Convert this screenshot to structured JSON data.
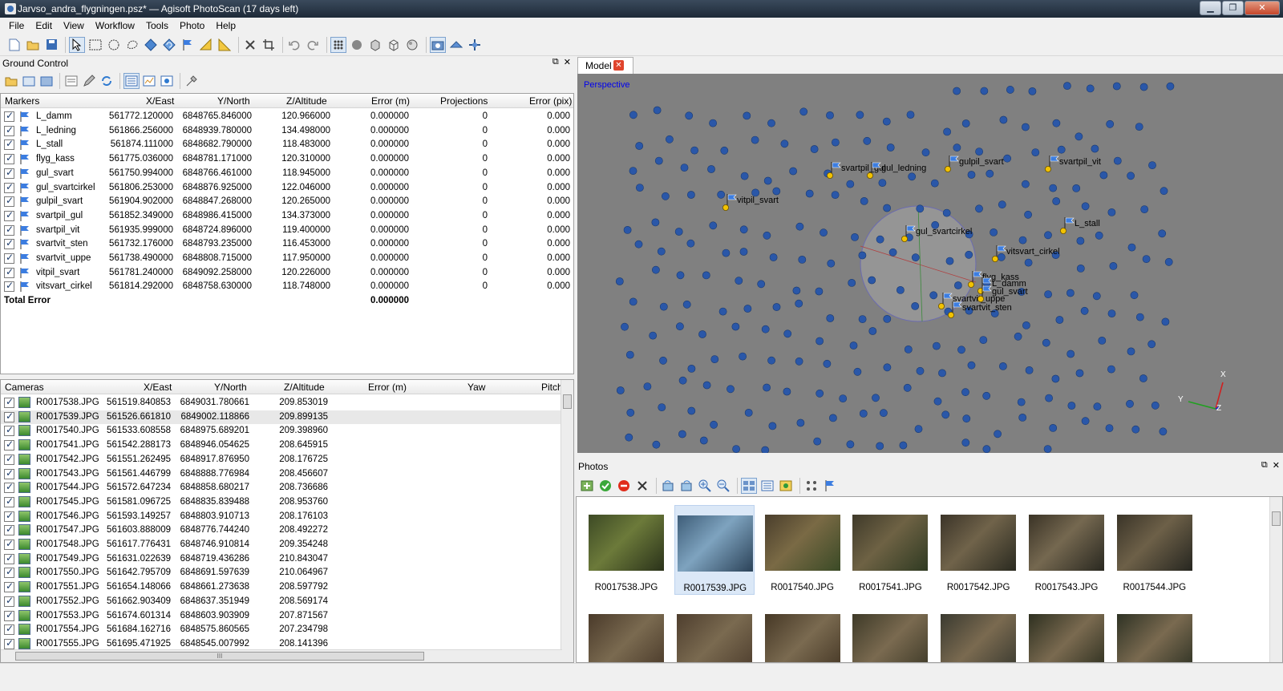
{
  "window": {
    "title": "Jarvso_andra_flygningen.psz* — Agisoft PhotoScan (17 days left)",
    "minimize": "▁",
    "maximize": "❐",
    "close": "✕"
  },
  "menu": [
    "File",
    "Edit",
    "View",
    "Workflow",
    "Tools",
    "Photo",
    "Help"
  ],
  "ground_control": {
    "title": "Ground Control",
    "float_label": "⧉",
    "close_label": "✕",
    "markers_headers": [
      "Markers",
      "X/East",
      "Y/North",
      "Z/Altitude",
      "Error (m)",
      "Projections",
      "Error (pix)"
    ],
    "markers": [
      {
        "name": "L_damm",
        "x": "561772.120000",
        "y": "6848765.846000",
        "z": "120.966000",
        "err": "0.000000",
        "proj": "0",
        "errpix": "0.000"
      },
      {
        "name": "L_ledning",
        "x": "561866.256000",
        "y": "6848939.780000",
        "z": "134.498000",
        "err": "0.000000",
        "proj": "0",
        "errpix": "0.000"
      },
      {
        "name": "L_stall",
        "x": "561874.111000",
        "y": "6848682.790000",
        "z": "118.483000",
        "err": "0.000000",
        "proj": "0",
        "errpix": "0.000"
      },
      {
        "name": "flyg_kass",
        "x": "561775.036000",
        "y": "6848781.171000",
        "z": "120.310000",
        "err": "0.000000",
        "proj": "0",
        "errpix": "0.000"
      },
      {
        "name": "gul_svart",
        "x": "561750.994000",
        "y": "6848766.461000",
        "z": "118.945000",
        "err": "0.000000",
        "proj": "0",
        "errpix": "0.000"
      },
      {
        "name": "gul_svartcirkel",
        "x": "561806.253000",
        "y": "6848876.925000",
        "z": "122.046000",
        "err": "0.000000",
        "proj": "0",
        "errpix": "0.000"
      },
      {
        "name": "gulpil_svart",
        "x": "561904.902000",
        "y": "6848847.268000",
        "z": "120.265000",
        "err": "0.000000",
        "proj": "0",
        "errpix": "0.000"
      },
      {
        "name": "svartpil_gul",
        "x": "561852.349000",
        "y": "6848986.415000",
        "z": "134.373000",
        "err": "0.000000",
        "proj": "0",
        "errpix": "0.000"
      },
      {
        "name": "svartpil_vit",
        "x": "561935.999000",
        "y": "6848724.896000",
        "z": "119.400000",
        "err": "0.000000",
        "proj": "0",
        "errpix": "0.000"
      },
      {
        "name": "svartvit_sten",
        "x": "561732.176000",
        "y": "6848793.235000",
        "z": "116.453000",
        "err": "0.000000",
        "proj": "0",
        "errpix": "0.000"
      },
      {
        "name": "svartvit_uppe",
        "x": "561738.490000",
        "y": "6848808.715000",
        "z": "117.950000",
        "err": "0.000000",
        "proj": "0",
        "errpix": "0.000"
      },
      {
        "name": "vitpil_svart",
        "x": "561781.240000",
        "y": "6849092.258000",
        "z": "120.226000",
        "err": "0.000000",
        "proj": "0",
        "errpix": "0.000"
      },
      {
        "name": "vitsvart_cirkel",
        "x": "561814.292000",
        "y": "6848758.630000",
        "z": "118.748000",
        "err": "0.000000",
        "proj": "0",
        "errpix": "0.000"
      }
    ],
    "total_error_label": "Total Error",
    "total_error_value": "0.000000",
    "cameras_headers": [
      "Cameras",
      "X/East",
      "Y/North",
      "Z/Altitude",
      "Error (m)",
      "Yaw",
      "Pitch"
    ],
    "cameras": [
      {
        "name": "R0017538.JPG",
        "x": "561519.840853",
        "y": "6849031.780661",
        "z": "209.853019"
      },
      {
        "name": "R0017539.JPG",
        "x": "561526.661810",
        "y": "6849002.118866",
        "z": "209.899135"
      },
      {
        "name": "R0017540.JPG",
        "x": "561533.608558",
        "y": "6848975.689201",
        "z": "209.398960"
      },
      {
        "name": "R0017541.JPG",
        "x": "561542.288173",
        "y": "6848946.054625",
        "z": "208.645915"
      },
      {
        "name": "R0017542.JPG",
        "x": "561551.262495",
        "y": "6848917.876950",
        "z": "208.176725"
      },
      {
        "name": "R0017543.JPG",
        "x": "561561.446799",
        "y": "6848888.776984",
        "z": "208.456607"
      },
      {
        "name": "R0017544.JPG",
        "x": "561572.647234",
        "y": "6848858.680217",
        "z": "208.736686"
      },
      {
        "name": "R0017545.JPG",
        "x": "561581.096725",
        "y": "6848835.839488",
        "z": "208.953760"
      },
      {
        "name": "R0017546.JPG",
        "x": "561593.149257",
        "y": "6848803.910713",
        "z": "208.176103"
      },
      {
        "name": "R0017547.JPG",
        "x": "561603.888009",
        "y": "6848776.744240",
        "z": "208.492272"
      },
      {
        "name": "R0017548.JPG",
        "x": "561617.776431",
        "y": "6848746.910814",
        "z": "209.354248"
      },
      {
        "name": "R0017549.JPG",
        "x": "561631.022639",
        "y": "6848719.436286",
        "z": "210.843047"
      },
      {
        "name": "R0017550.JPG",
        "x": "561642.795709",
        "y": "6848691.597639",
        "z": "210.064967"
      },
      {
        "name": "R0017551.JPG",
        "x": "561654.148066",
        "y": "6848661.273638",
        "z": "208.597792"
      },
      {
        "name": "R0017552.JPG",
        "x": "561662.903409",
        "y": "6848637.351949",
        "z": "208.569174"
      },
      {
        "name": "R0017553.JPG",
        "x": "561674.601314",
        "y": "6848603.903909",
        "z": "207.871567"
      },
      {
        "name": "R0017554.JPG",
        "x": "561684.162716",
        "y": "6848575.860565",
        "z": "207.234798"
      },
      {
        "name": "R0017555.JPG",
        "x": "561695.471925",
        "y": "6848545.007992",
        "z": "208.141396"
      }
    ],
    "hscroll_grip": "III"
  },
  "model": {
    "tab_label": "Model",
    "tab_close": "✕",
    "view_mode": "Perspective",
    "axis_labels": {
      "x": "X",
      "y": "Y",
      "z": "Z"
    },
    "marker_labels": [
      "svartpil_gul",
      "gul_ledning",
      "gulpil_svart",
      "svartpil_vit",
      "vitpil_svart",
      "gul_svartcirkel",
      "L_stall",
      "vitsvart_cirkel",
      "flyg_kass",
      "L_damm",
      "svartvit_uppe",
      "gul_svart",
      "svartvit_sten"
    ]
  },
  "photos": {
    "title": "Photos",
    "float_label": "⧉",
    "close_label": "✕",
    "selected": "R0017539.JPG",
    "items": [
      "R0017538.JPG",
      "R0017539.JPG",
      "R0017540.JPG",
      "R0017541.JPG",
      "R0017542.JPG",
      "R0017543.JPG",
      "R0017544.JPG"
    ]
  },
  "colors": {
    "viewport_bg": "#808080",
    "camera_dot": "#2a57a8",
    "marker_dot": "#f2c200",
    "accent_red": "#e0442c"
  }
}
